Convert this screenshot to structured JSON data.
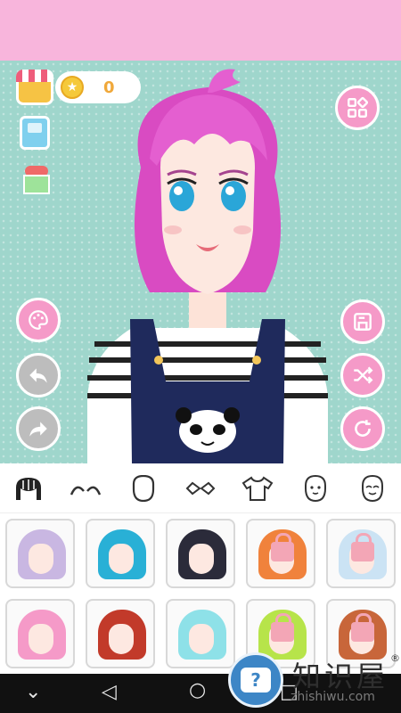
{
  "top": {
    "color": "#f8b5dc"
  },
  "coins": {
    "value": "0",
    "icon": "star-coin-icon"
  },
  "left_tools": [
    "shop-icon",
    "game-icon",
    "gift-icon"
  ],
  "right_tools": [
    "gallery-grid-icon",
    "save-icon",
    "shuffle-icon",
    "reset-icon"
  ],
  "left_actions": [
    "palette-icon",
    "undo-icon",
    "redo-icon"
  ],
  "tabs": [
    "hair",
    "eyebrows",
    "face",
    "eyes",
    "clothes",
    "mouth",
    "expression"
  ],
  "items": [
    {
      "hair_color": "#c9b7e2",
      "locked": false
    },
    {
      "hair_color": "#29b0d6",
      "locked": false
    },
    {
      "hair_color": "#2b2b3a",
      "locked": false
    },
    {
      "hair_color": "#f0823c",
      "locked": true
    },
    {
      "hair_color": "#cbe3f4",
      "locked": true
    },
    {
      "hair_color": "#f59ac8",
      "locked": false
    },
    {
      "hair_color": "#c23a2a",
      "locked": false
    },
    {
      "hair_color": "#8ee1e8",
      "locked": false
    },
    {
      "hair_color": "#b7e44a",
      "locked": true
    },
    {
      "hair_color": "#c8663a",
      "locked": true
    }
  ],
  "watermark": {
    "title": "知识屋",
    "subtitle": "zhishiwu.com",
    "reg": "®",
    "glyph": "?"
  },
  "colors": {
    "accent": "#f59ac8",
    "stage": "#9fd6cc"
  }
}
